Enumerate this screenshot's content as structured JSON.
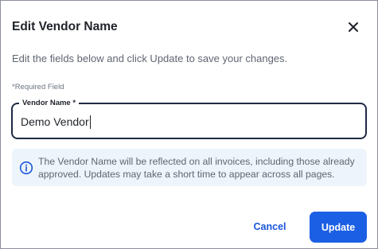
{
  "dialog": {
    "title": "Edit Vendor Name",
    "description": "Edit the fields below and click Update to save your changes.",
    "required_note": "*Required Field",
    "close_icon": "close-icon"
  },
  "field": {
    "label": "Vendor Name *",
    "value": "Demo Vendor"
  },
  "info": {
    "icon": "info-icon",
    "text": "The Vendor Name will be reflected on all invoices, including those already approved. Updates may take a short time to appear across all pages."
  },
  "actions": {
    "cancel_label": "Cancel",
    "update_label": "Update"
  },
  "colors": {
    "primary": "#1b5fe4",
    "link": "#1a56db",
    "info_bg": "#eef4fb",
    "field_border": "#1f2a44"
  }
}
